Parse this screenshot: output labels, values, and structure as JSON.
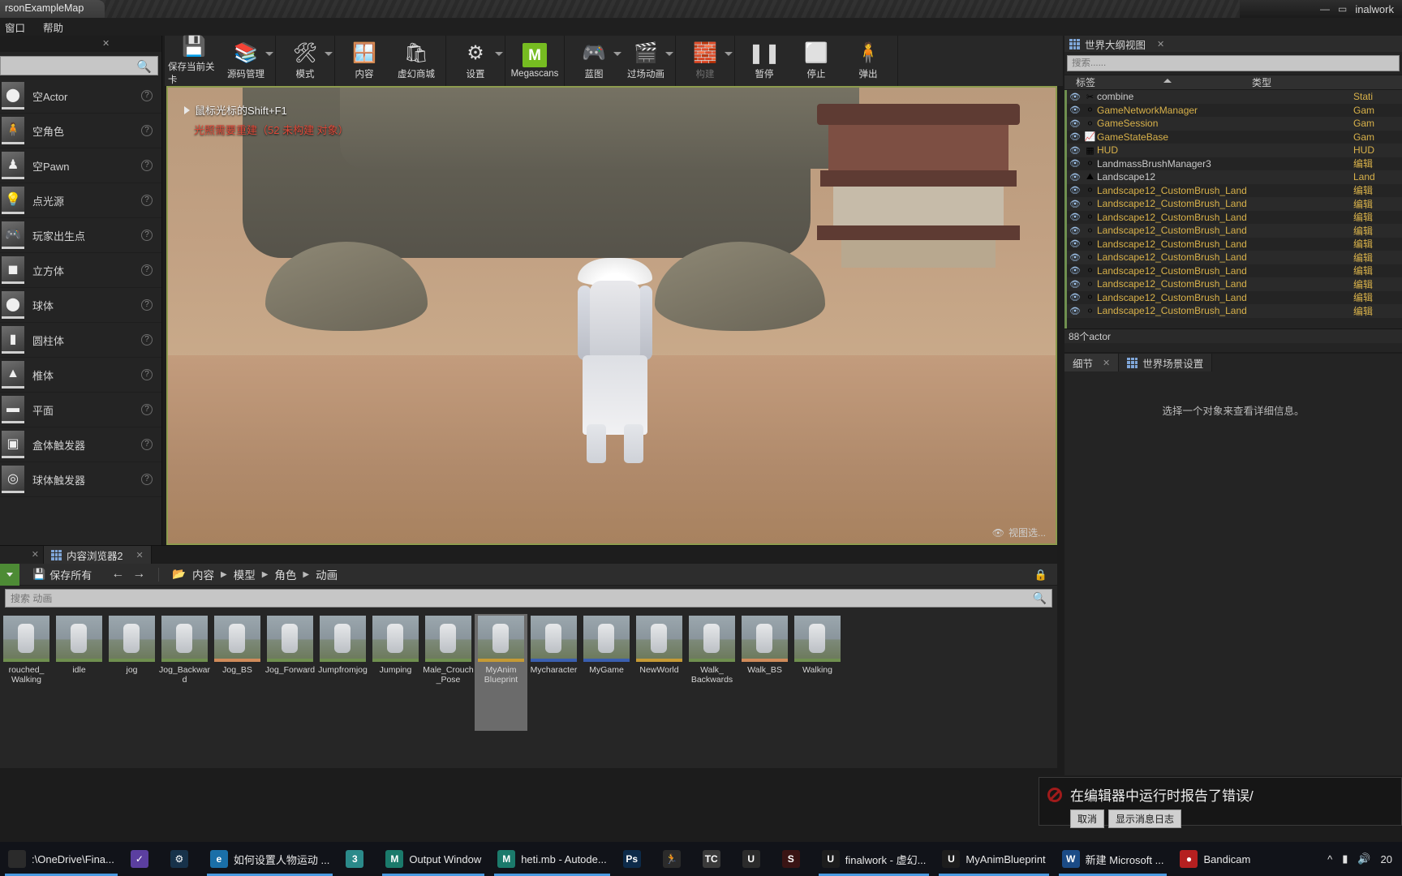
{
  "titlebar": {
    "doc_tab": "rsonExampleMap",
    "right_title": "inalwork",
    "min": "—",
    "max": "▭"
  },
  "menubar": {
    "items": [
      "窗口",
      "帮助"
    ]
  },
  "toolbar": {
    "groups": [
      {
        "buttons": [
          {
            "label": "保存当前关卡",
            "icon": "save-icon",
            "glyph": "💾",
            "caret": false,
            "dim": false
          },
          {
            "label": "源码管理",
            "icon": "source-control-icon",
            "glyph": "📚",
            "caret": true,
            "dim": false
          }
        ]
      },
      {
        "buttons": [
          {
            "label": "模式",
            "icon": "modes-icon",
            "glyph": "🛠",
            "caret": true,
            "dim": false
          }
        ]
      },
      {
        "buttons": [
          {
            "label": "内容",
            "icon": "content-icon",
            "glyph": "🪟",
            "caret": false,
            "dim": false
          },
          {
            "label": "虚幻商城",
            "icon": "marketplace-icon",
            "glyph": "🛍",
            "caret": false,
            "dim": false
          }
        ]
      },
      {
        "buttons": [
          {
            "label": "设置",
            "icon": "settings-gear-icon",
            "glyph": "⚙",
            "caret": true,
            "dim": false
          }
        ]
      },
      {
        "buttons": [
          {
            "label": "Megascans",
            "icon": "megascans-icon",
            "glyph": "M",
            "caret": false,
            "dim": false
          }
        ]
      },
      {
        "buttons": [
          {
            "label": "蓝图",
            "icon": "blueprint-icon",
            "glyph": "🎮",
            "caret": true,
            "dim": false
          },
          {
            "label": "过场动画",
            "icon": "cinematics-clapboard-icon",
            "glyph": "🎬",
            "caret": true,
            "dim": false
          }
        ]
      },
      {
        "buttons": [
          {
            "label": "构建",
            "icon": "build-icon",
            "glyph": "🧱",
            "caret": true,
            "dim": true
          }
        ]
      },
      {
        "buttons": [
          {
            "label": "暂停",
            "icon": "pause-icon",
            "glyph": "❚❚",
            "caret": false,
            "dim": false
          },
          {
            "label": "停止",
            "icon": "stop-icon",
            "glyph": "⬜",
            "caret": false,
            "dim": false
          },
          {
            "label": "弹出",
            "icon": "eject-icon",
            "glyph": "🧍",
            "caret": false,
            "dim": false
          }
        ]
      }
    ]
  },
  "place_actors": {
    "search_placeholder": "",
    "items": [
      {
        "label": "空Actor",
        "icon": "empty-actor-icon",
        "glyph": "⬤"
      },
      {
        "label": "空角色",
        "icon": "empty-character-icon",
        "glyph": "🧍"
      },
      {
        "label": "空Pawn",
        "icon": "empty-pawn-icon",
        "glyph": "♟"
      },
      {
        "label": "点光源",
        "icon": "point-light-icon",
        "glyph": "💡"
      },
      {
        "label": "玩家出生点",
        "icon": "player-start-icon",
        "glyph": "🎮"
      },
      {
        "label": "立方体",
        "icon": "cube-icon",
        "glyph": "◼"
      },
      {
        "label": "球体",
        "icon": "sphere-icon",
        "glyph": "⬤"
      },
      {
        "label": "圆柱体",
        "icon": "cylinder-icon",
        "glyph": "▮"
      },
      {
        "label": "椎体",
        "icon": "cone-icon",
        "glyph": "▲"
      },
      {
        "label": "平面",
        "icon": "plane-icon",
        "glyph": "▬"
      },
      {
        "label": "盒体触发器",
        "icon": "box-trigger-icon",
        "glyph": "▣"
      },
      {
        "label": "球体触发器",
        "icon": "sphere-trigger-icon",
        "glyph": "◎"
      }
    ]
  },
  "viewport": {
    "hint": "鼠标光标的Shift+F1",
    "warning": "光照需要重建（52 未构建 对象）",
    "bottom_label": "视图选..."
  },
  "outliner": {
    "title": "世界大纲视图",
    "search_placeholder": "搜索......",
    "col_tag": "标签",
    "col_type": "类型",
    "status": "88个actor",
    "rows": [
      {
        "tag": "combine",
        "type": "Stati",
        "icon": "cut-icon",
        "grey": true
      },
      {
        "tag": "GameNetworkManager",
        "type": "Gam",
        "icon": "sphere-icon",
        "grey": false
      },
      {
        "tag": "GameSession",
        "type": "Gam",
        "icon": "sphere-icon",
        "grey": false
      },
      {
        "tag": "GameStateBase",
        "type": "Gam",
        "icon": "gamestate-icon",
        "grey": false
      },
      {
        "tag": "HUD",
        "type": "HUD",
        "icon": "hud-icon",
        "grey": false
      },
      {
        "tag": "LandmassBrushManager3",
        "type": "编辑",
        "icon": "sphere-icon",
        "grey": true
      },
      {
        "tag": "Landscape12",
        "type": "Land",
        "icon": "landscape-icon",
        "grey": true
      },
      {
        "tag": "Landscape12_CustomBrush_Land",
        "type": "编辑",
        "icon": "sphere-icon",
        "grey": false
      },
      {
        "tag": "Landscape12_CustomBrush_Land",
        "type": "编辑",
        "icon": "sphere-icon",
        "grey": false
      },
      {
        "tag": "Landscape12_CustomBrush_Land",
        "type": "编辑",
        "icon": "sphere-icon",
        "grey": false
      },
      {
        "tag": "Landscape12_CustomBrush_Land",
        "type": "编辑",
        "icon": "sphere-icon",
        "grey": false
      },
      {
        "tag": "Landscape12_CustomBrush_Land",
        "type": "编辑",
        "icon": "sphere-icon",
        "grey": false
      },
      {
        "tag": "Landscape12_CustomBrush_Land",
        "type": "编辑",
        "icon": "sphere-icon",
        "grey": false
      },
      {
        "tag": "Landscape12_CustomBrush_Land",
        "type": "编辑",
        "icon": "sphere-icon",
        "grey": false
      },
      {
        "tag": "Landscape12_CustomBrush_Land",
        "type": "编辑",
        "icon": "sphere-icon",
        "grey": false
      },
      {
        "tag": "Landscape12_CustomBrush_Land",
        "type": "编辑",
        "icon": "sphere-icon",
        "grey": false
      },
      {
        "tag": "Landscape12_CustomBrush_Land",
        "type": "编辑",
        "icon": "sphere-icon",
        "grey": false
      }
    ]
  },
  "details": {
    "tab_details": "细节",
    "tab_world_settings": "世界场景设置",
    "empty_message": "选择一个对象来查看详细信息。"
  },
  "content_browser": {
    "tab_label": "内容浏览器2",
    "save_all": "保存所有",
    "breadcrumb": [
      "内容",
      "模型",
      "角色",
      "动画"
    ],
    "search_placeholder": "搜索 动画",
    "assets": [
      {
        "name": "rouched_\nWalking",
        "selected": false,
        "bar": "#6f8f4f"
      },
      {
        "name": "idle",
        "selected": false,
        "bar": "#6f8f4f"
      },
      {
        "name": "jog",
        "selected": false,
        "bar": "#6f8f4f"
      },
      {
        "name": "Jog_Backward",
        "selected": false,
        "bar": "#6f8f4f"
      },
      {
        "name": "Jog_BS",
        "selected": false,
        "bar": "#d08b5a"
      },
      {
        "name": "Jog_Forward",
        "selected": false,
        "bar": "#6f8f4f"
      },
      {
        "name": "Jumpfromjog",
        "selected": false,
        "bar": "#6f8f4f"
      },
      {
        "name": "Jumping",
        "selected": false,
        "bar": "#6f8f4f"
      },
      {
        "name": "Male_Crouch\n_Pose",
        "selected": false,
        "bar": "#6f8f4f"
      },
      {
        "name": "MyAnim\nBlueprint",
        "selected": true,
        "bar": "#c59a35"
      },
      {
        "name": "Mycharacter",
        "selected": false,
        "bar": "#3a5fb0"
      },
      {
        "name": "MyGame",
        "selected": false,
        "bar": "#3a5fb0"
      },
      {
        "name": "NewWorld",
        "selected": false,
        "bar": "#c59a35"
      },
      {
        "name": "Walk_\nBackwards",
        "selected": false,
        "bar": "#6f8f4f"
      },
      {
        "name": "Walk_BS",
        "selected": false,
        "bar": "#d08b5a"
      },
      {
        "name": "Walking",
        "selected": false,
        "bar": "#6f8f4f"
      }
    ]
  },
  "toast": {
    "message": "在编辑器中运行时报告了错误/",
    "cancel": "取消",
    "show_log": "显示消息日志"
  },
  "taskbar": {
    "items": [
      {
        "label": ":\\OneDrive\\Fina...",
        "icon": "explorer-icon",
        "color": "#2b2b2b",
        "glyph": "",
        "active": true
      },
      {
        "label": "",
        "icon": "checkmark-app-icon",
        "color": "#5b3fa0",
        "glyph": "✓",
        "active": false
      },
      {
        "label": "",
        "icon": "steam-icon",
        "color": "#17324a",
        "glyph": "⚙",
        "active": false
      },
      {
        "label": "如何设置人物运动 ...",
        "icon": "edge-browser-icon",
        "color": "#1a6fa8",
        "glyph": "e",
        "active": true
      },
      {
        "label": "",
        "icon": "3dsmax-icon",
        "color": "#2b8a8a",
        "glyph": "3",
        "active": false
      },
      {
        "label": "Output Window",
        "icon": "maya-icon",
        "color": "#1b7a6b",
        "glyph": "M",
        "active": true
      },
      {
        "label": "heti.mb - Autode...",
        "icon": "maya-icon",
        "color": "#1b7a6b",
        "glyph": "M",
        "active": true
      },
      {
        "label": "",
        "icon": "photoshop-icon",
        "color": "#0d2b4a",
        "glyph": "Ps",
        "active": false
      },
      {
        "label": "",
        "icon": "runner-app-icon",
        "color": "#2b2b2b",
        "glyph": "🏃",
        "active": false
      },
      {
        "label": "",
        "icon": "tc-icon",
        "color": "#3a3a3a",
        "glyph": "TC",
        "active": false
      },
      {
        "label": "",
        "icon": "unity-icon",
        "color": "#2b2b2b",
        "glyph": "U",
        "active": false
      },
      {
        "label": "",
        "icon": "substance-icon",
        "color": "#3a1414",
        "glyph": "S",
        "active": false
      },
      {
        "label": "finalwork - 虚幻...",
        "icon": "unreal-icon",
        "color": "#1d1d1d",
        "glyph": "U",
        "active": true
      },
      {
        "label": "MyAnimBlueprint",
        "icon": "unreal-icon",
        "color": "#1d1d1d",
        "glyph": "U",
        "active": true
      },
      {
        "label": "新建 Microsoft ...",
        "icon": "word-icon",
        "color": "#1b4b86",
        "glyph": "W",
        "active": true
      },
      {
        "label": "Bandicam",
        "icon": "bandicam-icon",
        "color": "#b52020",
        "glyph": "●",
        "active": false
      }
    ],
    "tray": {
      "chevron": "^",
      "battery": "▮",
      "volume": "🔊",
      "clock": "20"
    }
  }
}
